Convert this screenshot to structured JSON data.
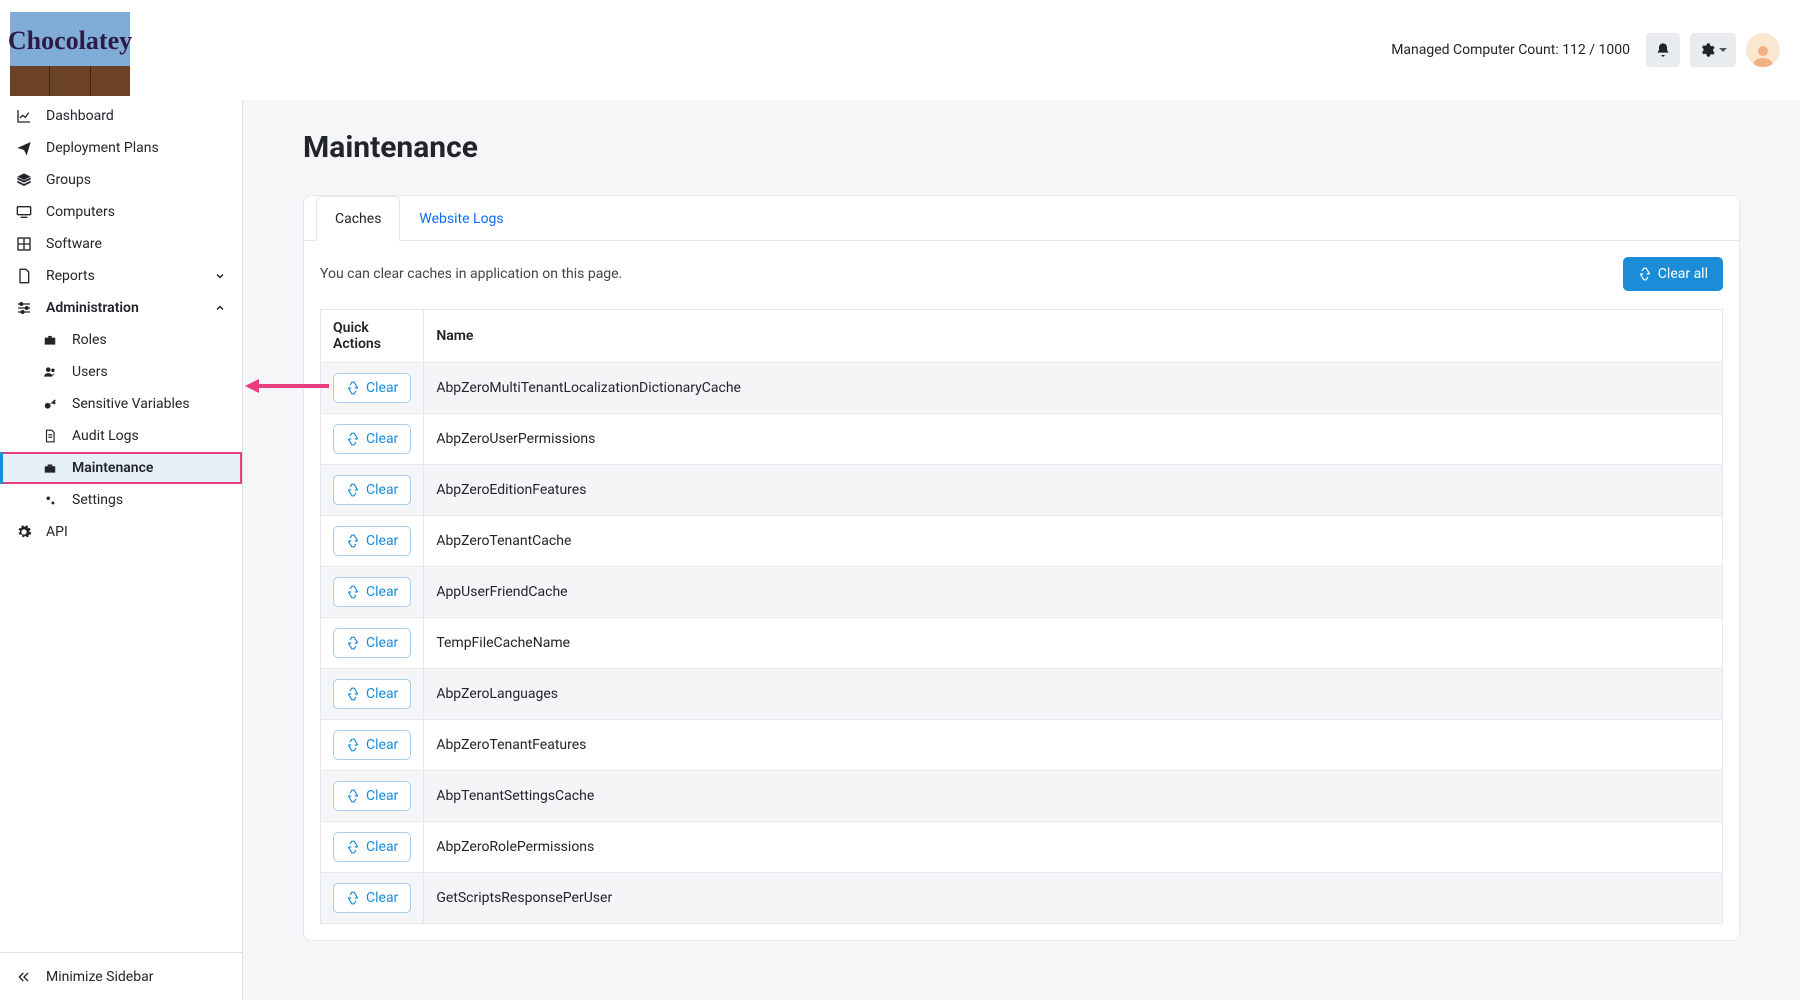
{
  "header": {
    "brand": "Chocolatey",
    "managed_count": "Managed Computer Count: 112 / 1000"
  },
  "sidebar": {
    "items": [
      {
        "label": "Dashboard"
      },
      {
        "label": "Deployment Plans"
      },
      {
        "label": "Groups"
      },
      {
        "label": "Computers"
      },
      {
        "label": "Software"
      },
      {
        "label": "Reports"
      },
      {
        "label": "Administration"
      }
    ],
    "admin_children": [
      {
        "label": "Roles"
      },
      {
        "label": "Users"
      },
      {
        "label": "Sensitive Variables"
      },
      {
        "label": "Audit Logs"
      },
      {
        "label": "Maintenance"
      },
      {
        "label": "Settings"
      }
    ],
    "api": "API",
    "minimize": "Minimize Sidebar"
  },
  "page": {
    "title": "Maintenance",
    "tabs": {
      "caches": "Caches",
      "logs": "Website Logs"
    },
    "desc": "You can clear caches in application on this page.",
    "clear_all": "Clear all",
    "clear": "Clear",
    "columns": {
      "actions": "Quick Actions",
      "name": "Name"
    },
    "rows": [
      "AbpZeroMultiTenantLocalizationDictionaryCache",
      "AbpZeroUserPermissions",
      "AbpZeroEditionFeatures",
      "AbpZeroTenantCache",
      "AppUserFriendCache",
      "TempFileCacheName",
      "AbpZeroLanguages",
      "AbpZeroTenantFeatures",
      "AbpTenantSettingsCache",
      "AbpZeroRolePermissions",
      "GetScriptsResponsePerUser"
    ]
  }
}
